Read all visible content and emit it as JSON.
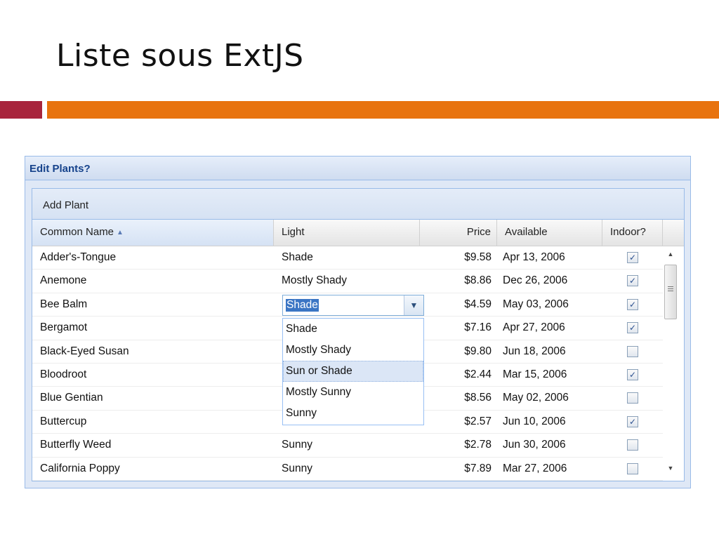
{
  "slide": {
    "title": "Liste sous ExtJS"
  },
  "panel": {
    "title": "Edit Plants?",
    "toolbar": {
      "add_label": "Add Plant"
    }
  },
  "grid": {
    "columns": {
      "name": "Common Name",
      "light": "Light",
      "price": "Price",
      "available": "Available",
      "indoor": "Indoor?"
    },
    "sort": {
      "column": "Common Name",
      "direction": "asc",
      "icon": "sort-ascending-icon"
    },
    "rows": [
      {
        "name": "Adder's-Tongue",
        "light": "Shade",
        "price": "$9.58",
        "available": "Apr 13, 2006",
        "indoor": true
      },
      {
        "name": "Anemone",
        "light": "Mostly Shady",
        "price": "$8.86",
        "available": "Dec 26, 2006",
        "indoor": true
      },
      {
        "name": "Bee Balm",
        "light": "Shade",
        "price": "$4.59",
        "available": "May 03, 2006",
        "indoor": true
      },
      {
        "name": "Bergamot",
        "light": "",
        "price": "$7.16",
        "available": "Apr 27, 2006",
        "indoor": true
      },
      {
        "name": "Black-Eyed Susan",
        "light": "",
        "price": "$9.80",
        "available": "Jun 18, 2006",
        "indoor": false
      },
      {
        "name": "Bloodroot",
        "light": "",
        "price": "$2.44",
        "available": "Mar 15, 2006",
        "indoor": true
      },
      {
        "name": "Blue Gentian",
        "light": "",
        "price": "$8.56",
        "available": "May 02, 2006",
        "indoor": false
      },
      {
        "name": "Buttercup",
        "light": "",
        "price": "$2.57",
        "available": "Jun 10, 2006",
        "indoor": true
      },
      {
        "name": "Butterfly Weed",
        "light": "Sunny",
        "price": "$2.78",
        "available": "Jun 30, 2006",
        "indoor": false
      },
      {
        "name": "California Poppy",
        "light": "Sunny",
        "price": "$7.89",
        "available": "Mar 27, 2006",
        "indoor": false
      }
    ]
  },
  "editor": {
    "value": "Shade",
    "options": [
      "Shade",
      "Mostly Shady",
      "Sun or Shade",
      "Mostly Sunny",
      "Sunny"
    ],
    "hovered_option": "Sun or Shade"
  },
  "colors": {
    "accent_red": "#a8243c",
    "accent_orange": "#e8730e",
    "panel_title": "#15428b",
    "selection": "#3a75c4"
  },
  "icons": {
    "combo_trigger": "chevron-down-icon",
    "checkbox": "check-icon",
    "scroll_up": "scroll-up-icon",
    "scroll_down": "scroll-down-icon"
  }
}
